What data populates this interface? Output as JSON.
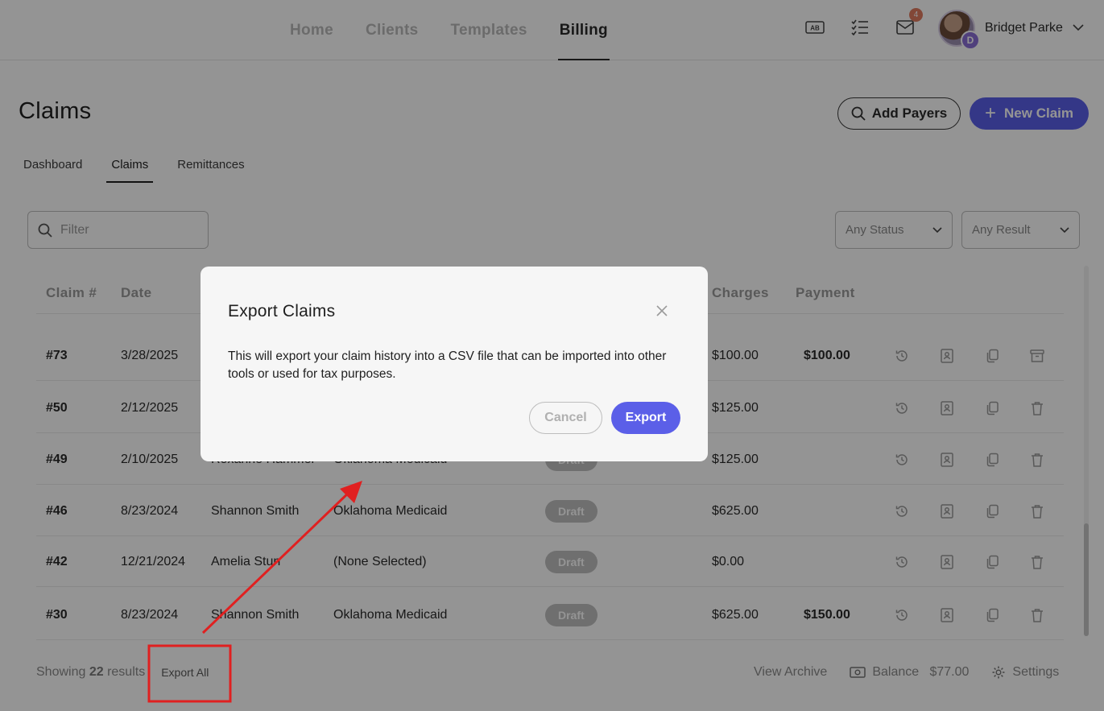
{
  "nav": {
    "items": [
      "Home",
      "Clients",
      "Templates",
      "Billing"
    ],
    "active_index": 3,
    "notification_count": "4",
    "user_name": "Bridget Parke",
    "avatar_initial": "D"
  },
  "page": {
    "title": "Claims",
    "add_payers_label": "Add Payers",
    "new_claim_label": "New Claim",
    "subtabs": [
      "Dashboard",
      "Claims",
      "Remittances"
    ],
    "active_subtab": 1
  },
  "filters": {
    "filter_placeholder": "Filter",
    "status_value": "Any Status",
    "result_value": "Any Result"
  },
  "table": {
    "headers": {
      "claim": "Claim #",
      "date": "Date",
      "charges": "Charges",
      "payment": "Payment"
    },
    "rows": [
      {
        "num": "#73",
        "date": "3/28/2025",
        "client": "",
        "payer": "",
        "status": "",
        "charges": "$100.00",
        "payment": "$100.00",
        "last_action": "archive-icon"
      },
      {
        "num": "#50",
        "date": "2/12/2025",
        "client": "",
        "payer": "",
        "status": "",
        "charges": "$125.00",
        "payment": "",
        "last_action": "trash-icon"
      },
      {
        "num": "#49",
        "date": "2/10/2025",
        "client": "Roxanne Hammer",
        "payer": "Oklahoma Medicaid",
        "status": "Draft",
        "charges": "$125.00",
        "payment": "",
        "last_action": "trash-icon"
      },
      {
        "num": "#46",
        "date": "8/23/2024",
        "client": "Shannon Smith",
        "payer": "Oklahoma Medicaid",
        "status": "Draft",
        "charges": "$625.00",
        "payment": "",
        "last_action": "trash-icon"
      },
      {
        "num": "#42",
        "date": "12/21/2024",
        "client": "Amelia Stun",
        "payer": "(None Selected)",
        "status": "Draft",
        "charges": "$0.00",
        "payment": "",
        "last_action": "trash-icon"
      },
      {
        "num": "#30",
        "date": "8/23/2024",
        "client": "Shannon Smith",
        "payer": "Oklahoma Medicaid",
        "status": "Draft",
        "charges": "$625.00",
        "payment": "$150.00",
        "last_action": "trash-icon"
      }
    ]
  },
  "footer": {
    "showing_prefix": "Showing",
    "result_count": "22",
    "showing_suffix": "results",
    "export_all_label": "Export All",
    "view_archive_label": "View Archive",
    "balance_label": "Balance",
    "balance_value": "$77.00",
    "settings_label": "Settings"
  },
  "modal": {
    "title": "Export Claims",
    "body": "This will export your claim history into a CSV file that can be imported into other tools or used for tax purposes.",
    "cancel_label": "Cancel",
    "export_label": "Export"
  },
  "colors": {
    "accent": "#5b5fe8",
    "annotation": "#e02020",
    "badge": "#e07a5f"
  }
}
